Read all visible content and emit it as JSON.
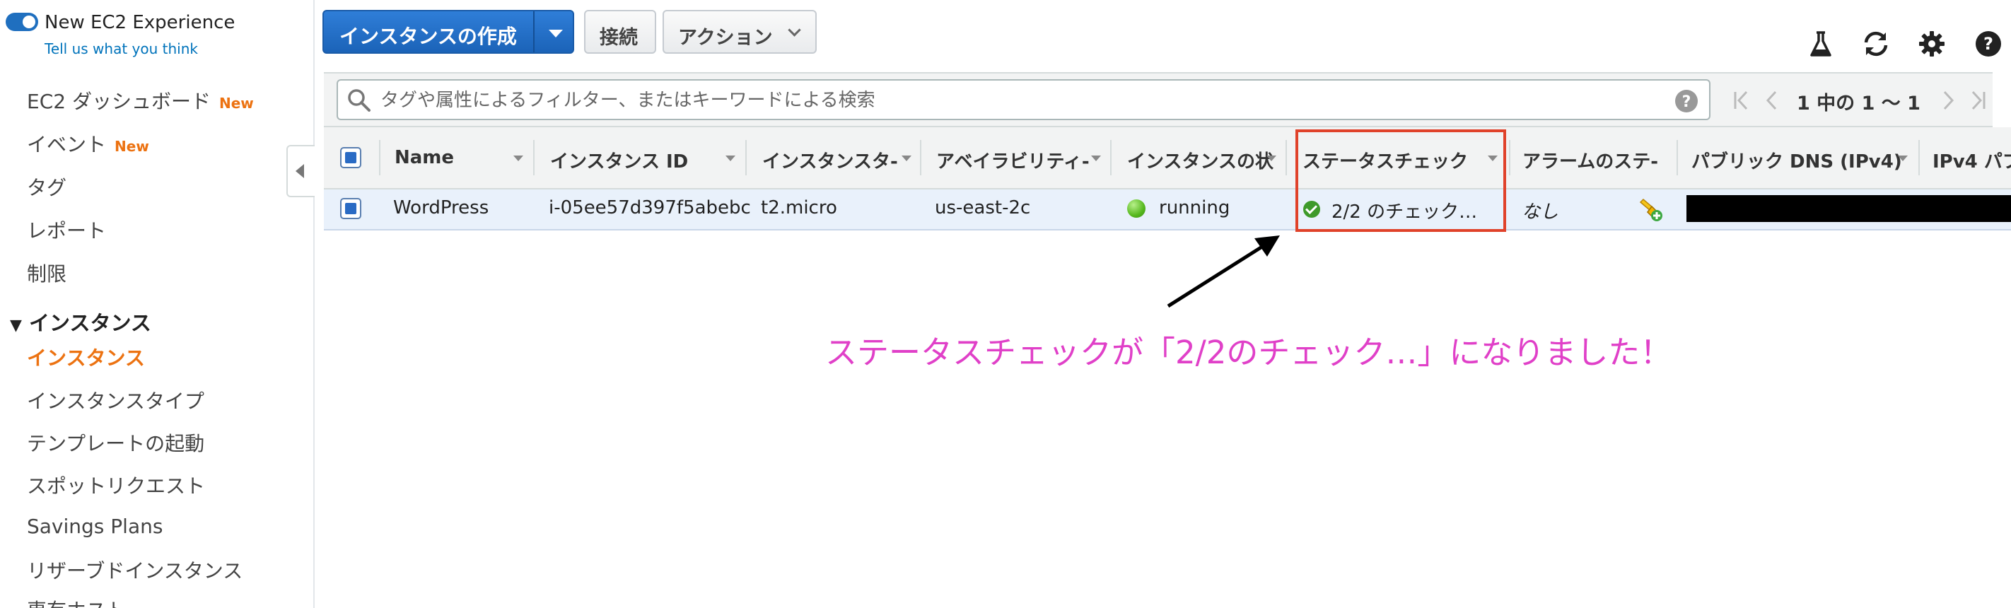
{
  "sidebar": {
    "experience_toggle_label": "New EC2 Experience",
    "feedback_link": "Tell us what you think",
    "items": [
      {
        "label": "EC2 ダッシュボード",
        "badge": "New"
      },
      {
        "label": "イベント",
        "badge": "New"
      },
      {
        "label": "タグ"
      },
      {
        "label": "レポート"
      },
      {
        "label": "制限"
      }
    ],
    "section_title": "インスタンス",
    "section_items": [
      {
        "label": "インスタンス",
        "active": true
      },
      {
        "label": "インスタンスタイプ"
      },
      {
        "label": "テンプレートの起動"
      },
      {
        "label": "スポットリクエスト"
      },
      {
        "label": "Savings Plans"
      },
      {
        "label": "リザーブドインスタンス"
      },
      {
        "label": "専有ホスト"
      }
    ]
  },
  "toolbar": {
    "create_instance_label": "インスタンスの作成",
    "connect_label": "接続",
    "actions_label": "アクション",
    "icons": [
      "flask-icon",
      "refresh-icon",
      "gear-icon",
      "help-icon"
    ]
  },
  "search": {
    "placeholder": "タグや属性によるフィルター、またはキーワードによる検索",
    "pagination": "1 中の 1 〜 1"
  },
  "table": {
    "columns": [
      "Name",
      "インスタンス ID",
      "インスタンスタ-",
      "アベイラビリティ-",
      "インスタンスの状",
      "ステータスチェック",
      "アラームのステ-",
      "パブリック DNS (IPv4)",
      "IPv4 パブ"
    ],
    "rows": [
      {
        "name": "WordPress",
        "instance_id": "i-05ee57d397f5abebc",
        "instance_type": "t2.micro",
        "availability_zone": "us-east-2c",
        "state": "running",
        "status_check": "2/2 のチェック…",
        "alarm_status": "なし"
      }
    ]
  },
  "annotation": {
    "text": "ステータスチェックが「2/2のチェック…」になりました！",
    "color": "#e040c8",
    "highlight_color": "#e0422a"
  },
  "colors": {
    "primary": "#1b63b8",
    "accent": "#ec7211",
    "running": "#56b81e"
  }
}
